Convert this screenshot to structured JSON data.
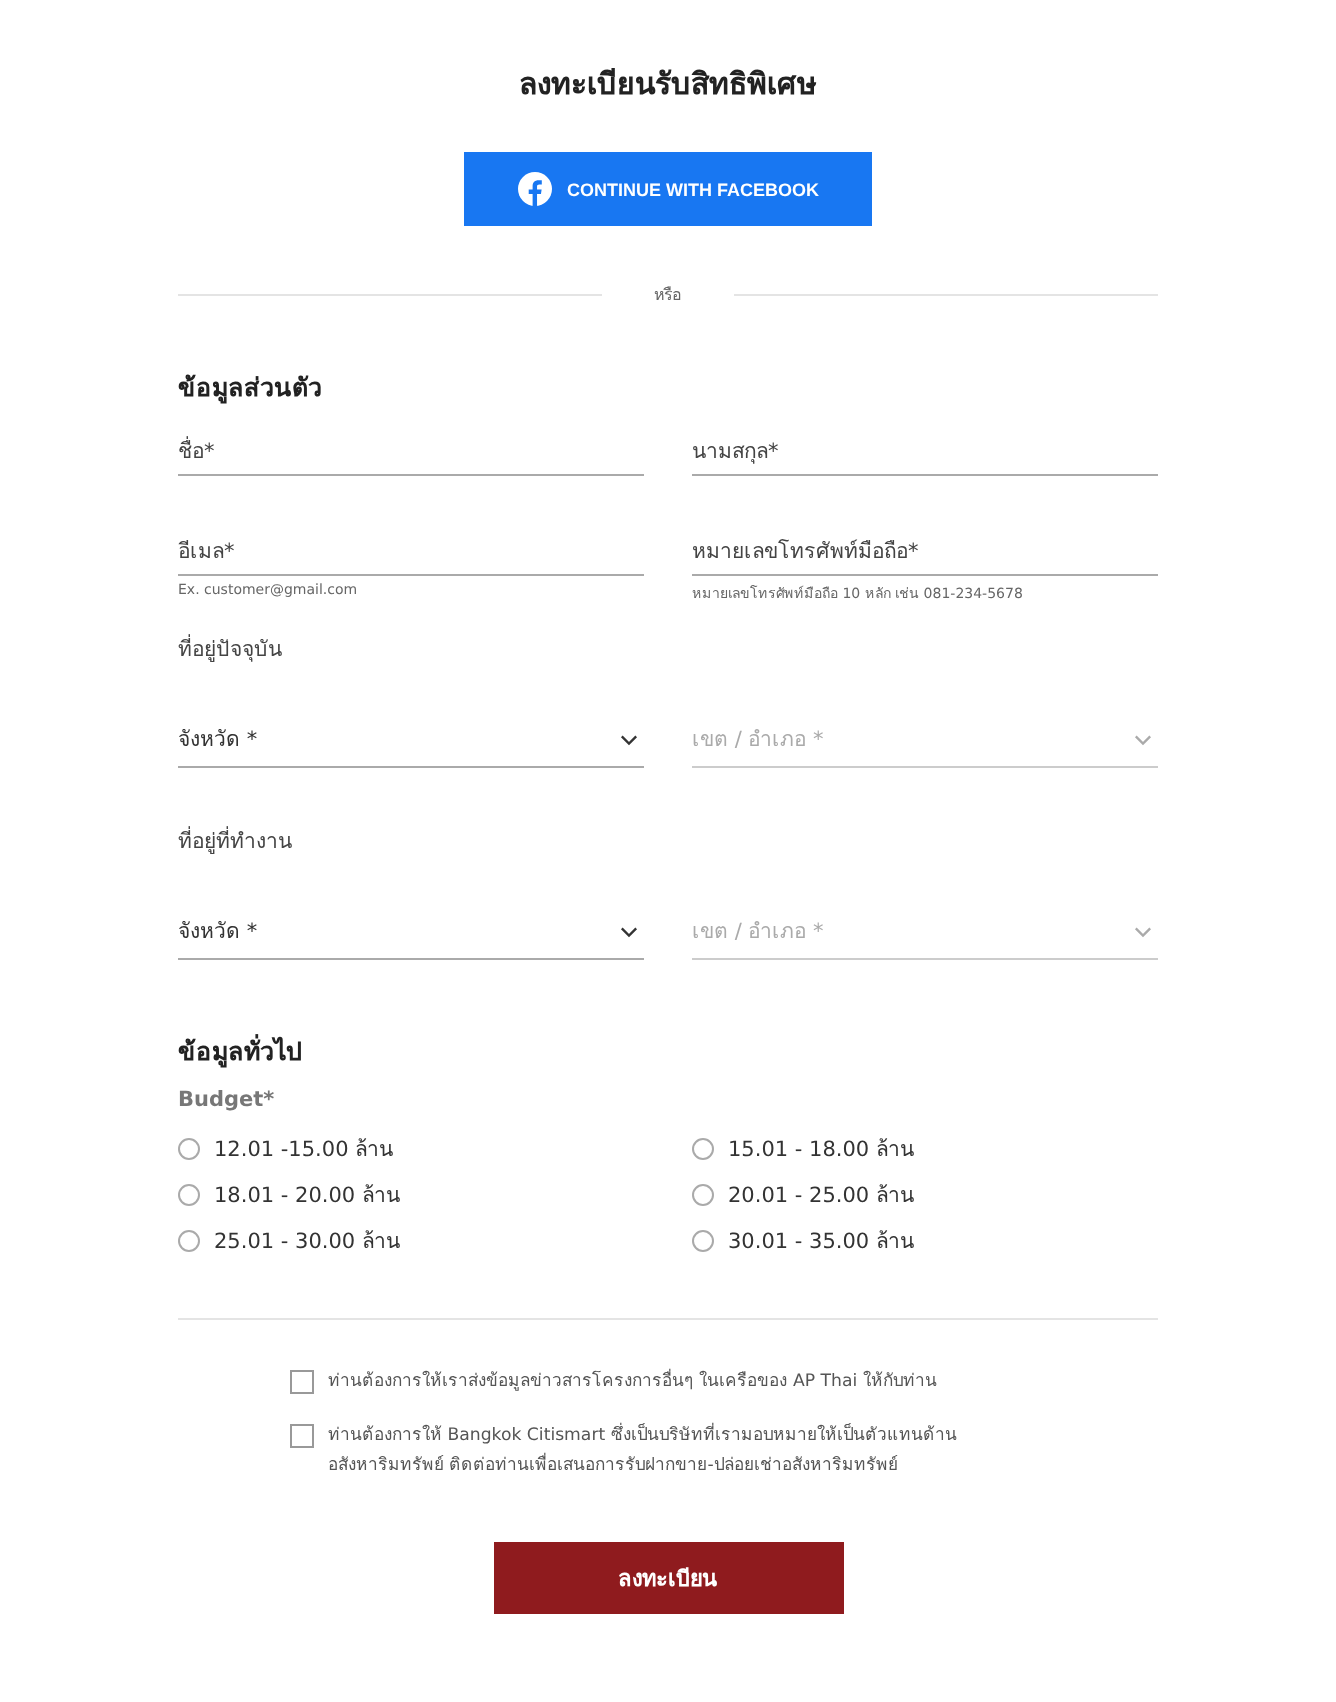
{
  "title": "ลงทะเบียนรับสิทธิพิเศษ",
  "facebook_button": {
    "label": "CONTINUE WITH FACEBOOK"
  },
  "divider_label": "หรือ",
  "sections": [
    {
      "heading": "ข้อมูลส่วนตัว",
      "rows": [
        {
          "fields": [
            {
              "kind": "text",
              "placeholder": "ชื่อ*"
            },
            {
              "kind": "text",
              "placeholder": "นามสกุล*"
            }
          ]
        },
        {
          "fields": [
            {
              "kind": "text",
              "placeholder": "อีเมล*",
              "hint": "Ex. customer@gmail.com"
            },
            {
              "kind": "text",
              "placeholder": "หมายเลขโทรศัพท์มือถือ*",
              "hint": "หมายเลขโทรศัพท์มือถือ 10 หลัก เช่น 081-234-5678"
            }
          ]
        },
        {
          "label": "ที่อยู่ปัจจุบัน",
          "fields": [
            {
              "kind": "select",
              "placeholder": "จังหวัด *",
              "disabled": false
            },
            {
              "kind": "select",
              "placeholder": "เขต / อำเภอ *",
              "disabled": true
            }
          ]
        },
        {
          "label": "ที่อยู่ที่ทำงาน",
          "fields": [
            {
              "kind": "select",
              "placeholder": "จังหวัด *",
              "disabled": false
            },
            {
              "kind": "select",
              "placeholder": "เขต / อำเภอ *",
              "disabled": true
            }
          ]
        }
      ]
    }
  ],
  "general": {
    "heading": "ข้อมูลทั่วไป",
    "budget_label": "Budget*",
    "options": [
      {
        "label": "12.01 -15.00 ล้าน",
        "selected": false
      },
      {
        "label": "15.01 - 18.00 ล้าน",
        "selected": false
      },
      {
        "label": "18.01 - 20.00 ล้าน",
        "selected": false
      },
      {
        "label": "20.01 - 25.00 ล้าน",
        "selected": false
      },
      {
        "label": "25.01 - 30.00 ล้าน",
        "selected": false
      },
      {
        "label": "30.01 - 35.00 ล้าน",
        "selected": false
      }
    ]
  },
  "consents": [
    {
      "label": "ท่านต้องการให้เราส่งข้อมูลข่าวสารโครงการอื่นๆ ในเครือของ AP Thai ให้กับท่าน",
      "checked": false
    },
    {
      "label": "ท่านต้องการให้ Bangkok Citismart ซึ่งเป็นบริษัทที่เรามอบหมายให้เป็นตัวแทนด้านอสังหาริมทรัพย์ ติดต่อท่านเพื่อเสนอการรับฝากขาย-ปล่อยเช่าอสังหาริมทรัพย์",
      "checked": false
    }
  ],
  "submit_button": {
    "label": "ลงทะเบียน"
  }
}
